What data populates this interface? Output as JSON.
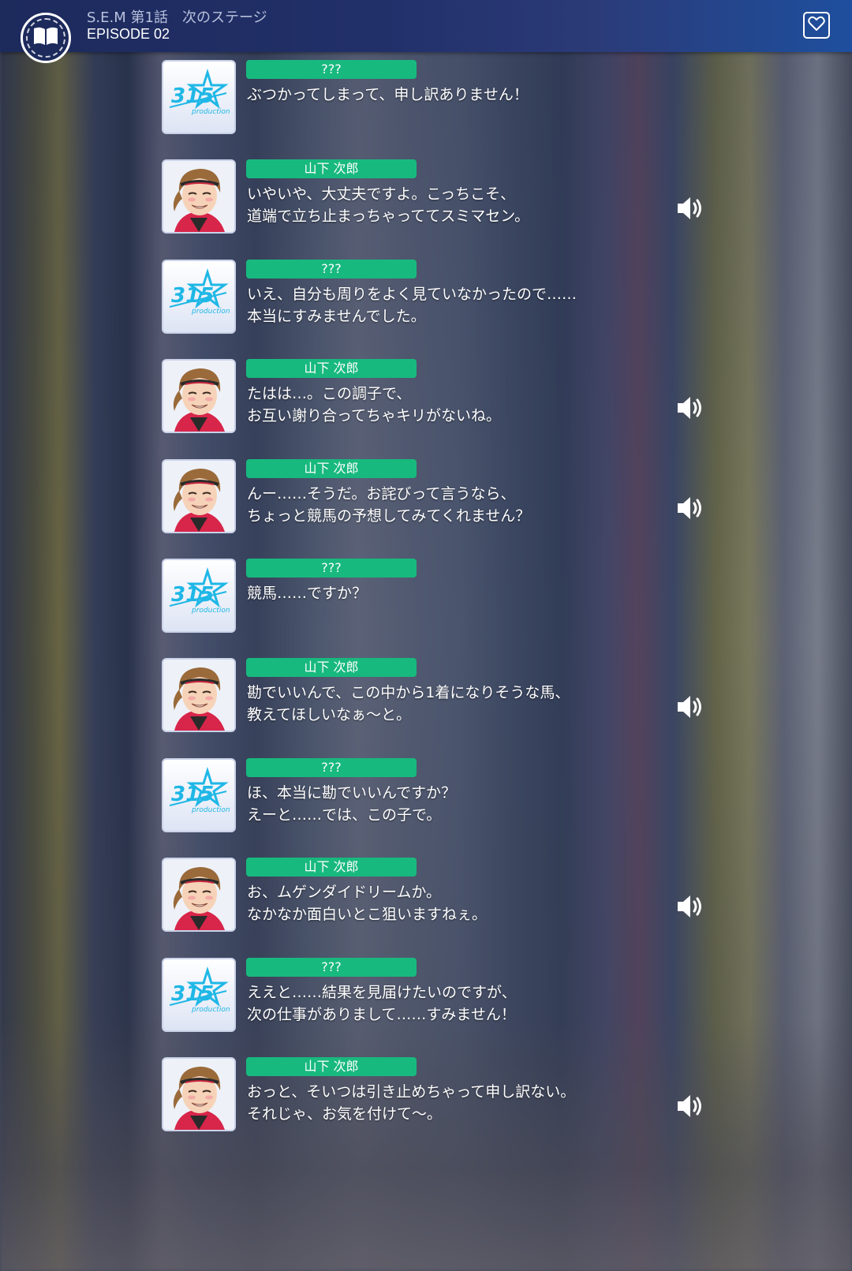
{
  "header": {
    "subtitle": "S.E.M 第1話　次のステージ",
    "title": "EPISODE 02",
    "book_icon": "book-icon",
    "favorite_icon": "heart-icon"
  },
  "colors": {
    "name_tag": "#18b97e",
    "header": "#22306a"
  },
  "messages": [
    {
      "speaker": "???",
      "avatar": "315-logo",
      "text": "ぶつかってしまって、申し訳ありません！",
      "voice": false
    },
    {
      "speaker": "山下 次郎",
      "avatar": "jiro",
      "text": "いやいや、大丈夫ですよ。こっちこそ、\n道端で立ち止まっちゃっててスミマセン。",
      "voice": true
    },
    {
      "speaker": "???",
      "avatar": "315-logo",
      "text": "いえ、自分も周りをよく見ていなかったので……\n本当にすみませんでした。",
      "voice": false
    },
    {
      "speaker": "山下 次郎",
      "avatar": "jiro",
      "text": "たはは…。この調子で、\nお互い謝り合ってちゃキリがないね。",
      "voice": true
    },
    {
      "speaker": "山下 次郎",
      "avatar": "jiro",
      "text": "んー……そうだ。お詫びって言うなら、\nちょっと競馬の予想してみてくれません？",
      "voice": true
    },
    {
      "speaker": "???",
      "avatar": "315-logo",
      "text": "競馬……ですか？",
      "voice": false
    },
    {
      "speaker": "山下 次郎",
      "avatar": "jiro",
      "text": "勘でいいんで、この中から1着になりそうな馬、\n教えてほしいなぁ～と。",
      "voice": true
    },
    {
      "speaker": "???",
      "avatar": "315-logo",
      "text": "ほ、本当に勘でいいんですか？\nえーと……では、この子で。",
      "voice": false
    },
    {
      "speaker": "山下 次郎",
      "avatar": "jiro",
      "text": "お、ムゲンダイドリームか。\nなかなか面白いとこ狙いますねぇ。",
      "voice": true
    },
    {
      "speaker": "???",
      "avatar": "315-logo",
      "text": "ええと……結果を見届けたいのですが、\n次の仕事がありまして……すみません！",
      "voice": false
    },
    {
      "speaker": "山下 次郎",
      "avatar": "jiro",
      "text": "おっと、そいつは引き止めちゃって申し訳ない。\nそれじゃ、お気を付けて～。",
      "voice": true
    }
  ]
}
